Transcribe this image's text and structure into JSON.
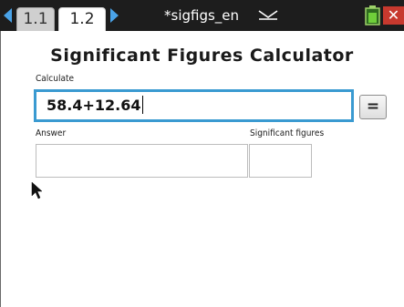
{
  "titlebar": {
    "tabs": [
      {
        "label": "1.1"
      },
      {
        "label": "1.2"
      }
    ],
    "doc_title": "*sigfigs_en",
    "close_label": "✕"
  },
  "main": {
    "app_title": "Significant Figures Calculator",
    "calculate_label": "Calculate",
    "calculate_value": "58.4+12.64",
    "equals_label": "=",
    "answer_label": "Answer",
    "answer_value": "",
    "sigfigs_label": "Significant figures",
    "sigfigs_value": ""
  },
  "colors": {
    "titlebar_bg": "#1d1d1d",
    "accent_blue": "#3a9ad1",
    "nav_arrow": "#4aa3e8",
    "close_red": "#c7392e"
  },
  "icons": [
    "nav-left-icon",
    "nav-right-icon",
    "dropdown-chevron-icon",
    "battery-icon",
    "close-icon",
    "mouse-pointer-icon"
  ]
}
